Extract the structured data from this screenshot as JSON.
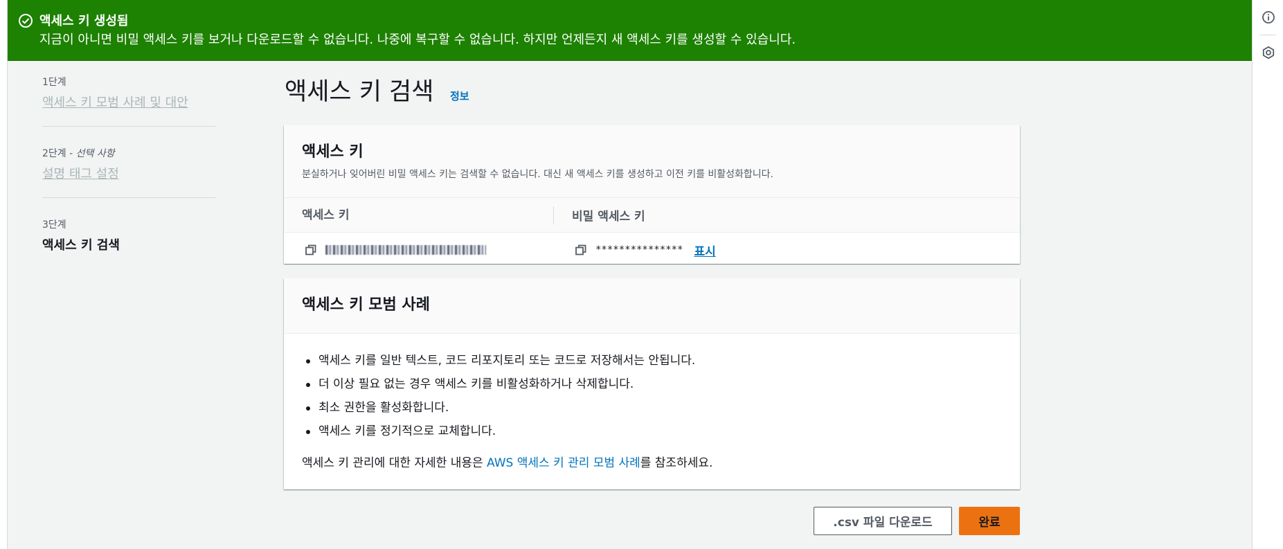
{
  "flash": {
    "title": "액세스 키 생성됨",
    "message": "지금이 아니면 비밀 액세스 키를 보거나 다운로드할 수 없습니다. 나중에 복구할 수 없습니다. 하지만 언제든지 새 액세스 키를 생성할 수 있습니다.",
    "icon": "check-circle-icon",
    "color": "#1d8102"
  },
  "steps": [
    {
      "number": "1단계",
      "optional": "",
      "label": "액세스 키 모범 사례 및 대안"
    },
    {
      "number": "2단계 - ",
      "optional": "선택 사항",
      "label": "설명 태그 설정"
    },
    {
      "number": "3단계",
      "optional": "",
      "label": "액세스 키 검색"
    }
  ],
  "page": {
    "title": "액세스 키 검색",
    "info_link": "정보"
  },
  "access_key_panel": {
    "title": "액세스 키",
    "description": "분실하거나 잊어버린 비밀 액세스 키는 검색할 수 없습니다. 대신 새 액세스 키를 생성하고 이전 키를 비활성화합니다.",
    "col_access_key": "액세스 키",
    "col_secret_key": "비밀 액세스 키",
    "secret_masked": "***************",
    "show_link": "표시"
  },
  "best_practices": {
    "title": "액세스 키 모범 사례",
    "items": [
      "액세스 키를 일반 텍스트, 코드 리포지토리 또는 코드로 저장해서는 안됩니다.",
      "더 이상 필요 없는 경우 액세스 키를 비활성화하거나 삭제합니다.",
      "최소 권한을 활성화합니다.",
      "액세스 키를 정기적으로 교체합니다."
    ],
    "more_prefix": "액세스 키 관리에 대한 자세한 내용은 ",
    "more_link": "AWS 액세스 키 관리 모범 사례",
    "more_suffix": "를 참조하세요."
  },
  "footer": {
    "download_csv": ".csv 파일 다운로드",
    "done": "완료"
  },
  "colors": {
    "primary": "#ec7211",
    "link": "#0073bb",
    "success": "#1d8102"
  }
}
